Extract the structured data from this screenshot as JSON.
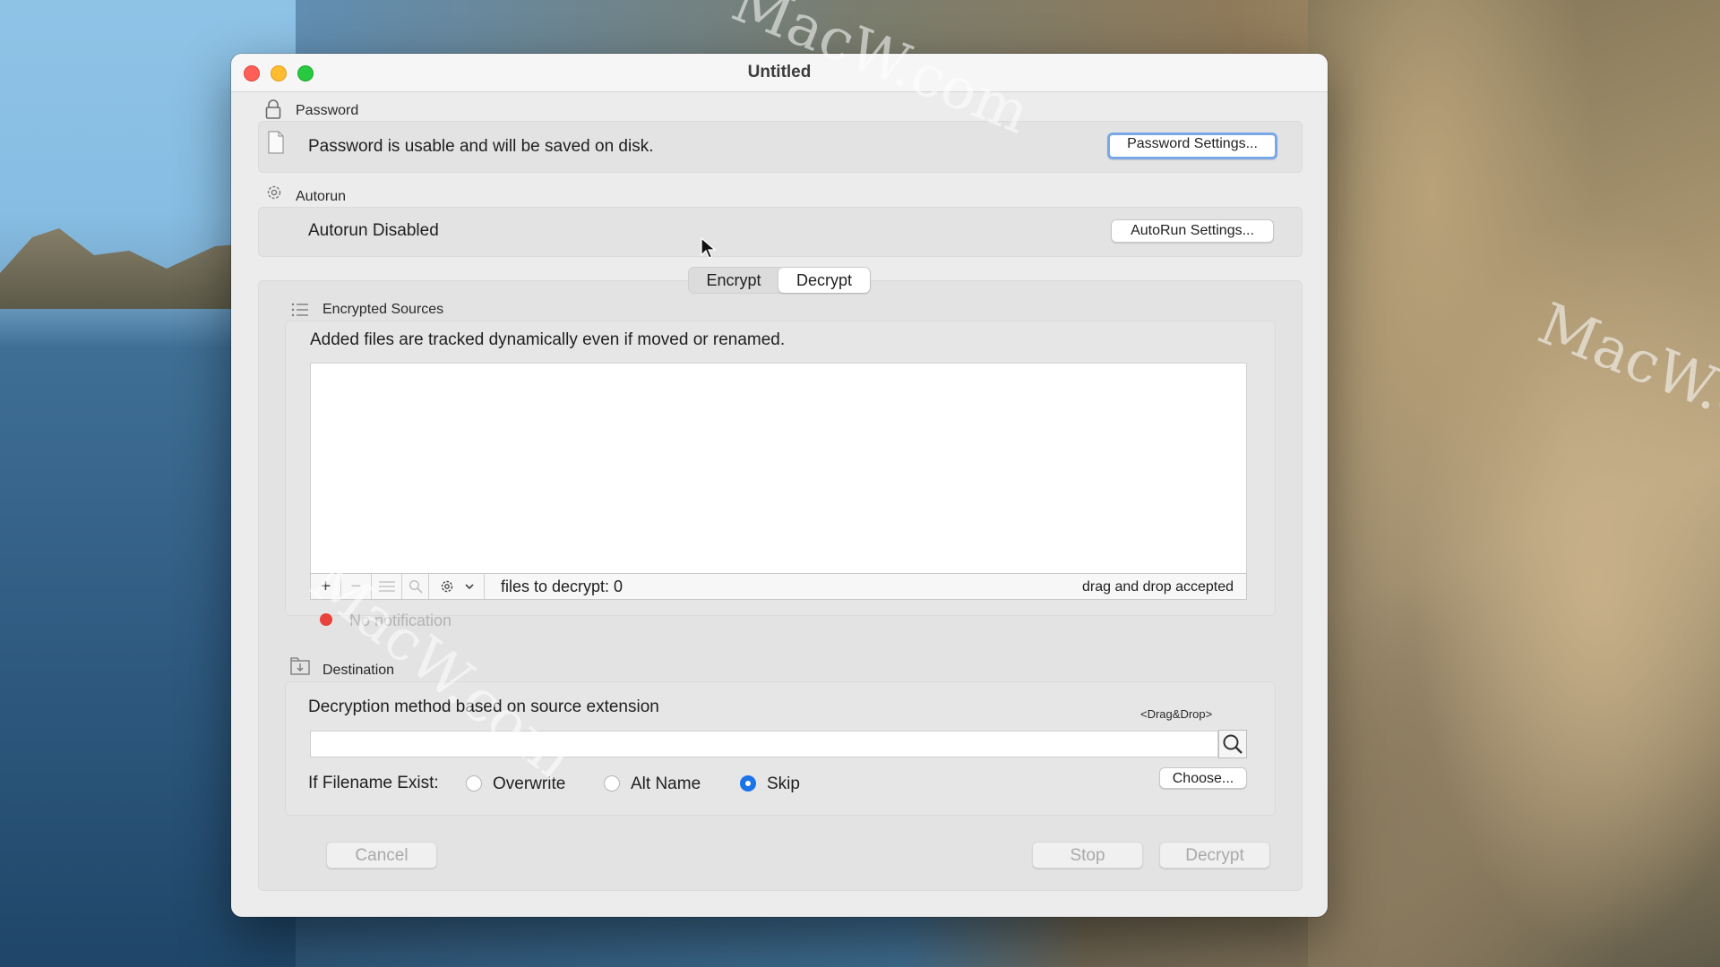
{
  "window": {
    "title": "Untitled"
  },
  "password": {
    "section_label": "Password",
    "status_text": "Password is usable and will be saved on disk.",
    "settings_button": "Password Settings..."
  },
  "autorun": {
    "section_label": "Autorun",
    "status_text": "Autorun Disabled",
    "settings_button": "AutoRun Settings..."
  },
  "mode_tabs": {
    "encrypt": "Encrypt",
    "decrypt": "Decrypt",
    "selected": "Decrypt"
  },
  "sources": {
    "section_label": "Encrypted Sources",
    "description": "Added files are tracked dynamically  even if moved or renamed.",
    "files_count_text": "files to decrypt: 0",
    "drag_drop_hint": "drag and drop accepted",
    "notification_text": "No notification"
  },
  "destination": {
    "section_label": "Destination",
    "method_text": "Decryption method based on source extension",
    "drag_drop_tag": "<Drag&Drop>",
    "path_value": "",
    "filename_exist_label": "If Filename Exist:",
    "options": [
      "Overwrite",
      "Alt Name",
      "Skip"
    ],
    "selected_option": "Skip",
    "choose_button": "Choose..."
  },
  "actions": {
    "cancel": "Cancel",
    "stop": "Stop",
    "decrypt": "Decrypt"
  },
  "watermark": "MacW.com",
  "colors": {
    "accent": "#1a74e8",
    "close": "#fe5f57",
    "minimize": "#febc2e",
    "maximize": "#28c840",
    "status_dot": "#e9413b"
  }
}
